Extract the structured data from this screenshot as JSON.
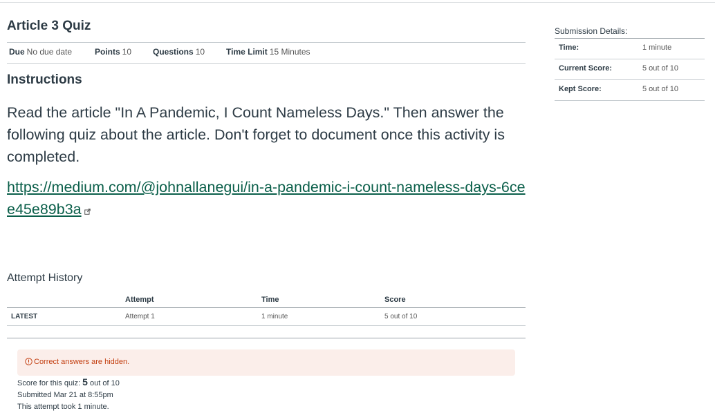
{
  "quiz": {
    "title": "Article 3 Quiz",
    "meta": {
      "due_label": "Due",
      "due_value": "No due date",
      "points_label": "Points",
      "points_value": "10",
      "questions_label": "Questions",
      "questions_value": "10",
      "time_limit_label": "Time Limit",
      "time_limit_value": "15 Minutes"
    }
  },
  "instructions": {
    "heading": "Instructions",
    "text": "Read the article \"In A Pandemic, I Count Nameless Days.\" Then answer the following quiz about the article. Don't forget to document once this activity is completed.",
    "link_text": "https://medium.com/@johnallanegui/in-a-pandemic-i-count-nameless-days-6cee45e89b3a",
    "link_icon": "external-link-icon"
  },
  "attempt_history": {
    "title": "Attempt History",
    "columns": [
      "",
      "Attempt",
      "Time",
      "Score"
    ],
    "rows": [
      {
        "tag": "LATEST",
        "attempt": "Attempt 1",
        "time": "1 minute",
        "score": "5 out of 10"
      }
    ]
  },
  "results": {
    "hidden_notice": "Correct answers are hidden.",
    "notice_icon": "warning-circle-icon",
    "score_prefix": "Score for this quiz: ",
    "score_value": "5",
    "score_suffix": " out of 10",
    "submitted": "Submitted Mar 21 at 8:55pm",
    "duration": "This attempt took 1 minute."
  },
  "submission_details": {
    "title": "Submission Details:",
    "rows": [
      {
        "label": "Time:",
        "value": "1 minute"
      },
      {
        "label": "Current Score:",
        "value": "5 out of 10"
      },
      {
        "label": "Kept Score:",
        "value": "5 out of 10"
      }
    ]
  },
  "colors": {
    "link": "#0b5f4a",
    "warning": "#c23c0d",
    "warning_bg": "#fbeeea",
    "text": "#2d3b45"
  }
}
